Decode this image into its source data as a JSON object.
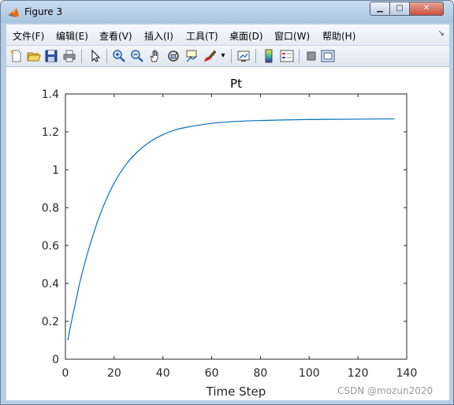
{
  "window": {
    "title": "Figure 3",
    "minimize_glyph": "▁",
    "maximize_glyph": "□",
    "close_glyph": "✕"
  },
  "menu": {
    "items": [
      "文件(F)",
      "编辑(E)",
      "查看(V)",
      "插入(I)",
      "工具(T)",
      "桌面(D)",
      "窗口(W)",
      "帮助(H)"
    ],
    "overflow_glyph": "↘"
  },
  "toolbar": {
    "icons": [
      "new-figure-icon",
      "open-file-icon",
      "save-icon",
      "print-icon",
      "pointer-icon",
      "zoom-in-icon",
      "zoom-out-icon",
      "pan-hand-icon",
      "rotate-3d-icon",
      "data-cursor-icon",
      "brush-icon",
      "link-plot-icon",
      "colorbar-icon",
      "legend-icon",
      "hide-plot-tools-icon",
      "show-plot-tools-icon"
    ],
    "dropdown_glyph": "▾"
  },
  "colors": {
    "line": "#0072bd",
    "axes": "#262626",
    "accent_close": "#c8503a"
  },
  "watermark": "CSDN @mozun2020",
  "chart_data": {
    "type": "line",
    "title": "Pt",
    "xlabel": "Time Step",
    "ylabel": "",
    "xlim": [
      0,
      140
    ],
    "ylim": [
      0,
      1.4
    ],
    "xticks": [
      "0",
      "20",
      "40",
      "60",
      "80",
      "100",
      "120",
      "140"
    ],
    "yticks": [
      "0",
      "0.2",
      "0.4",
      "0.6",
      "0.8",
      "1",
      "1.2",
      "1.4"
    ],
    "grid": false,
    "series": [
      {
        "values_x": [
          1,
          2,
          4,
          6,
          8,
          10,
          13,
          16,
          20,
          25,
          30,
          35,
          40,
          45,
          50,
          60,
          70,
          80,
          90,
          100,
          110,
          120,
          130,
          135
        ],
        "values_y": [
          0.1,
          0.17,
          0.29,
          0.41,
          0.51,
          0.6,
          0.72,
          0.82,
          0.93,
          1.03,
          1.1,
          1.15,
          1.185,
          1.21,
          1.225,
          1.245,
          1.255,
          1.26,
          1.263,
          1.265,
          1.266,
          1.267,
          1.268,
          1.268
        ]
      }
    ]
  }
}
